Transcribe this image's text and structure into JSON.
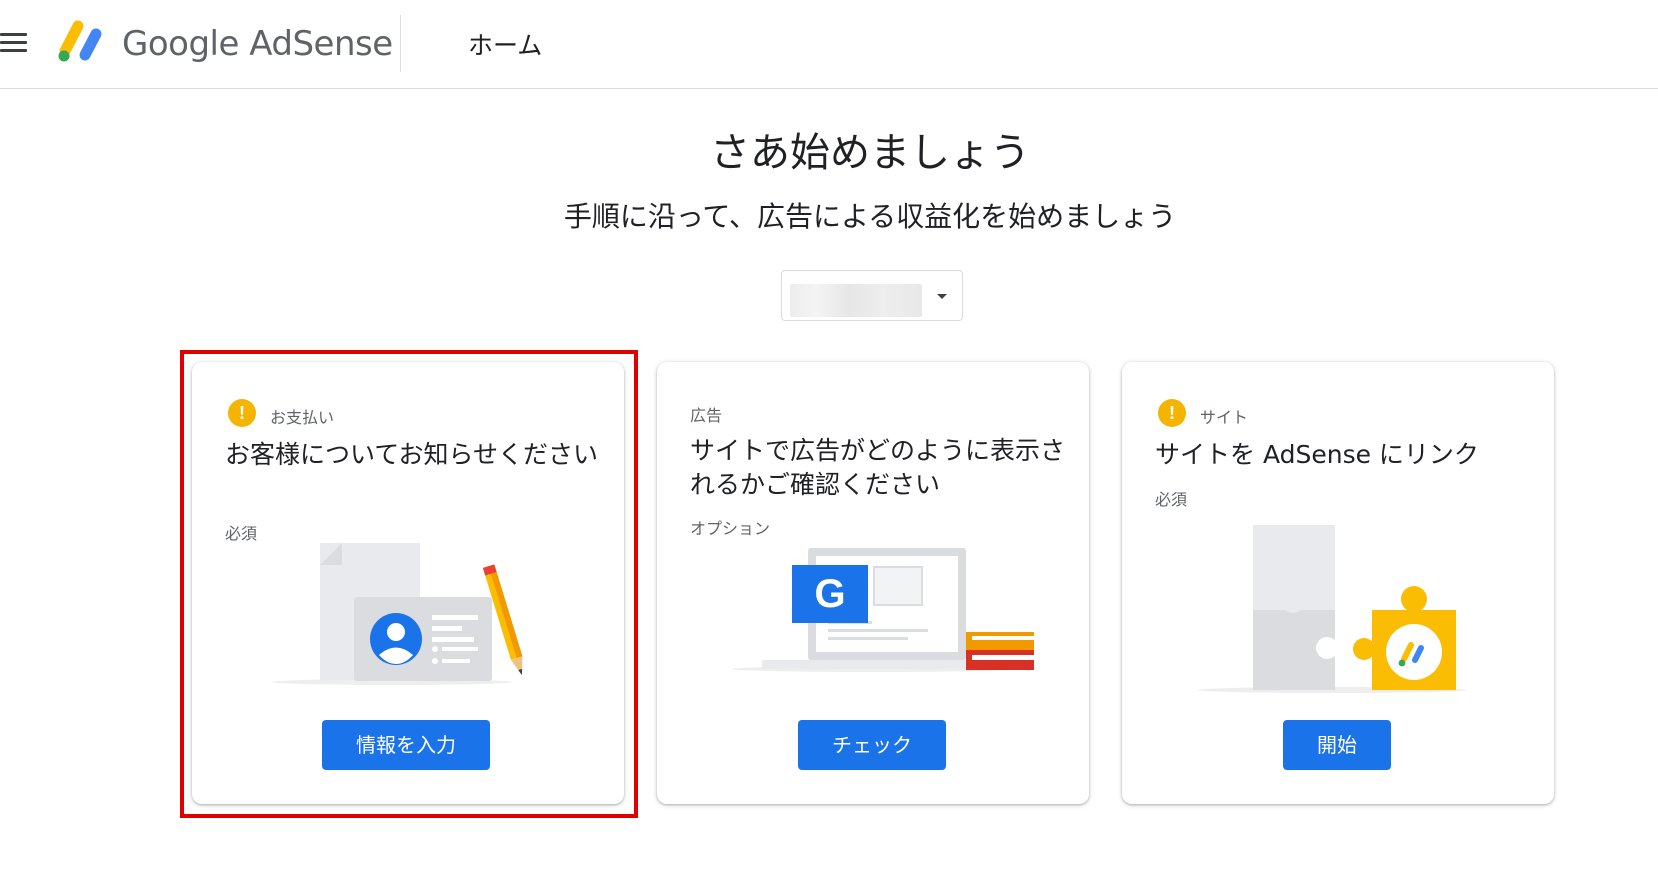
{
  "header": {
    "menu_icon": "hamburger-menu-icon",
    "logo_icon": "adsense-logo-icon",
    "logo_text": "Google AdSense",
    "page_title": "ホーム"
  },
  "main": {
    "title": "さあ始めましょう",
    "subtitle": "手順に沿って、広告による収益化を始めましょう",
    "site_selector": {
      "value": "",
      "dropdown_icon": "dropdown-caret-icon"
    }
  },
  "cards": [
    {
      "status_icon": "warning-icon",
      "category": "お支払い",
      "title": "お客様についてお知らせください",
      "requirement": "必須",
      "illustration": "payment-profile-illustration",
      "button_label": "情報を入力",
      "highlighted": true
    },
    {
      "status_icon": "",
      "category": "広告",
      "title": "サイトで広告がどのように表示されるかご確認ください",
      "requirement": "オプション",
      "illustration": "ad-preview-illustration",
      "button_label": "チェック",
      "highlighted": false
    },
    {
      "status_icon": "warning-icon",
      "category": "サイト",
      "title": "サイトを AdSense にリンク",
      "requirement": "必須",
      "illustration": "site-puzzle-illustration",
      "button_label": "開始",
      "highlighted": false
    }
  ],
  "colors": {
    "primary_button": "#1a73e8",
    "warning": "#f4b400",
    "highlight_border": "#e00000",
    "text_primary": "#202124",
    "text_secondary": "#5f6368"
  }
}
